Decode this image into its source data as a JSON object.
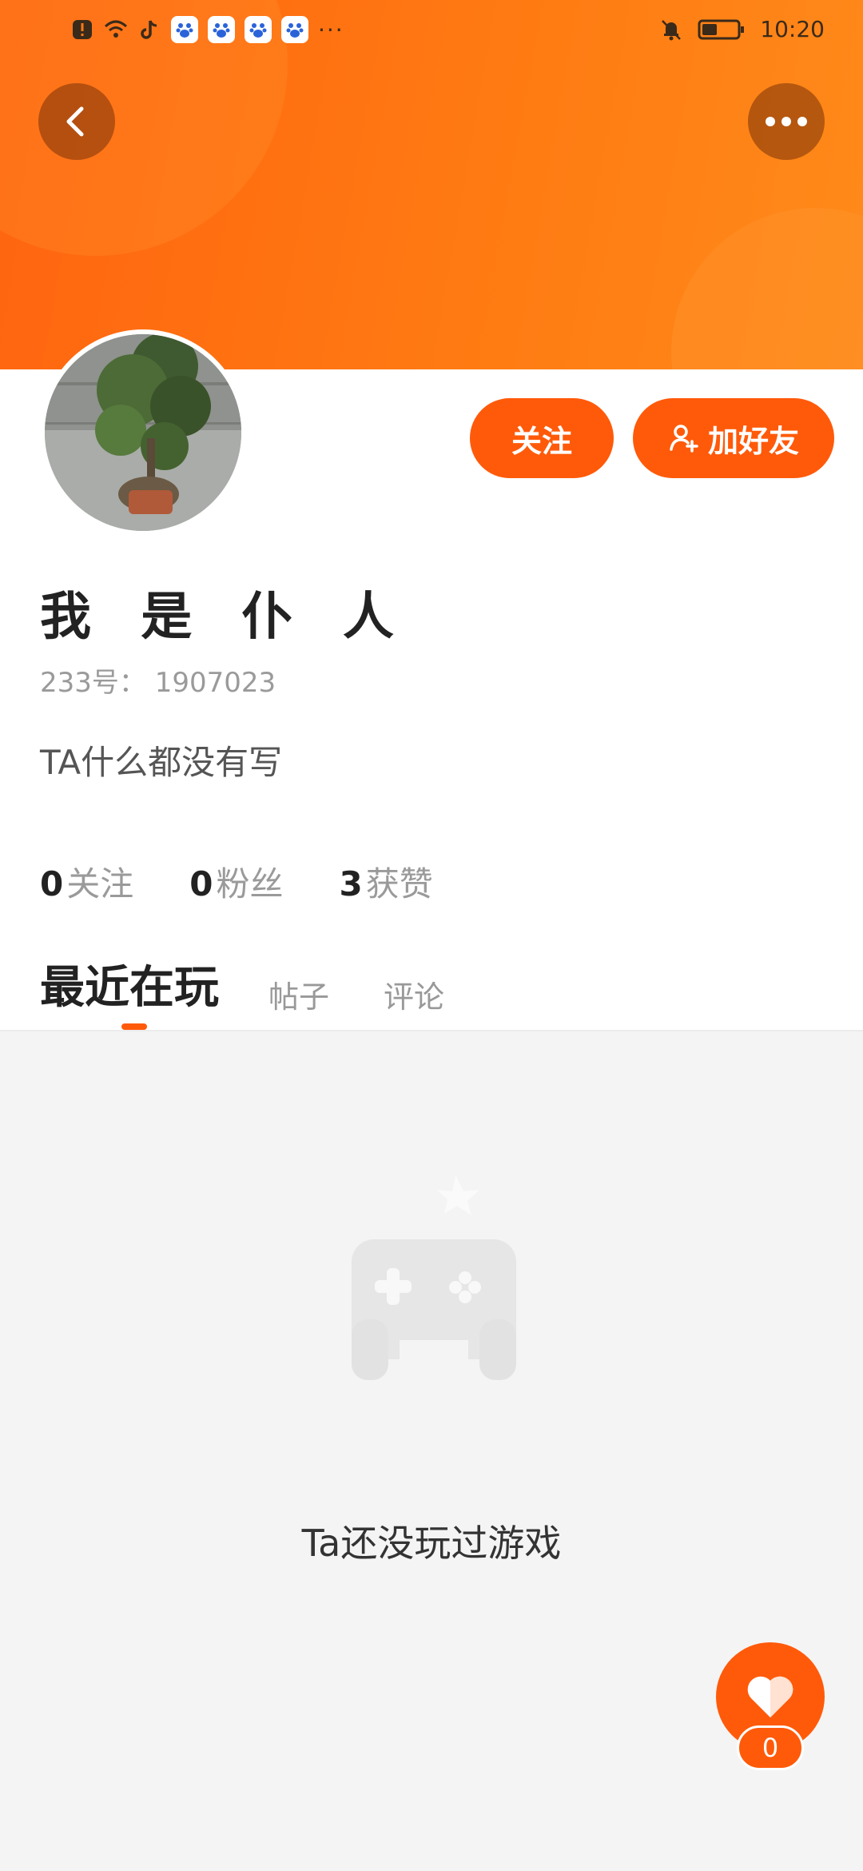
{
  "status_bar": {
    "time": "10:20",
    "more_indicator": "···",
    "icons": [
      "alert-icon",
      "wifi-icon",
      "tiktok-icon",
      "baidu-paw-icon",
      "baidu-paw-icon",
      "baidu-paw-icon",
      "baidu-paw-icon",
      "bell-muted-icon",
      "battery-icon"
    ]
  },
  "header": {
    "back_icon": "chevron-left-icon",
    "more_icon": "more-horizontal-icon",
    "gradient_start": "#ff6410",
    "gradient_end": "#ff8a1a"
  },
  "actions": {
    "follow_label": "关注",
    "add_friend_label": "加好友",
    "accent_color": "#ff5a0a"
  },
  "profile": {
    "name": "我 是 仆 人",
    "uid": "233号： 1907023",
    "bio": "TA什么都没有写"
  },
  "stats": [
    {
      "num": "0",
      "label": "关注"
    },
    {
      "num": "0",
      "label": "粉丝"
    },
    {
      "num": "3",
      "label": "获赞"
    }
  ],
  "tabs": [
    {
      "label": "最近在玩",
      "active": true
    },
    {
      "label": "帖子",
      "active": false
    },
    {
      "label": "评论",
      "active": false
    }
  ],
  "empty_state": {
    "icon": "gamepad-icon",
    "text": "Ta还没玩过游戏"
  },
  "like_fab": {
    "icon": "heart-icon",
    "count": "0"
  }
}
